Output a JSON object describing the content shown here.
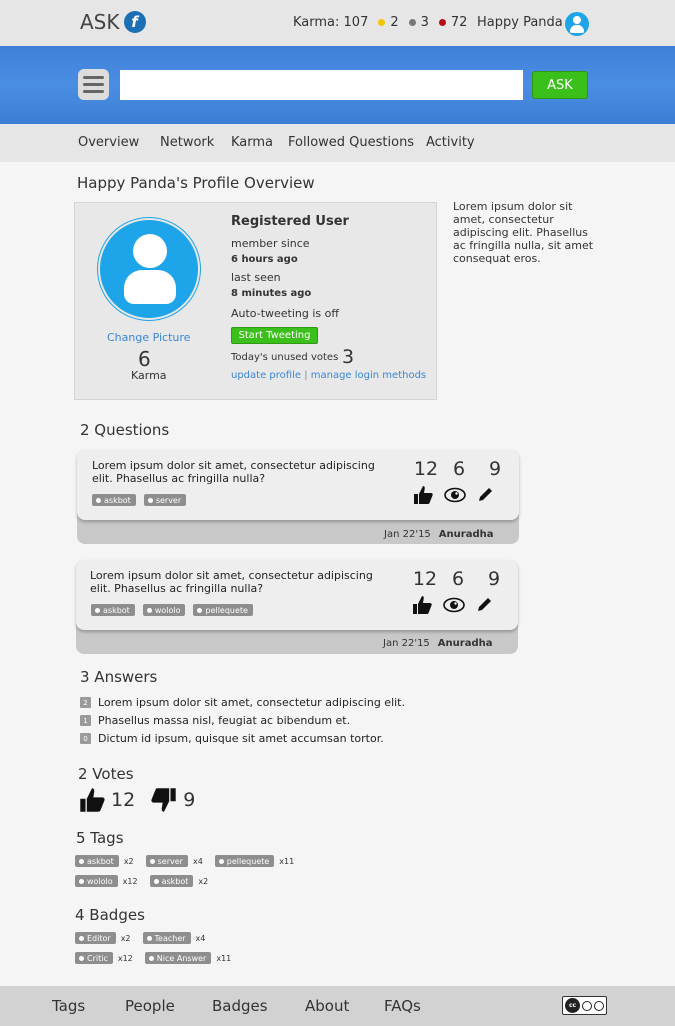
{
  "header": {
    "logo_text": "ASK",
    "logo_mark": "f",
    "karma_label": "Karma: 107",
    "badges": [
      {
        "count": "2",
        "color": "#f5c400"
      },
      {
        "count": "3",
        "color": "#777777"
      },
      {
        "count": "72",
        "color": "#b50f0f"
      }
    ],
    "username": "Happy Panda"
  },
  "search": {
    "placeholder": "",
    "button": "ASK"
  },
  "nav": [
    "Overview",
    "Network",
    "Karma",
    "Followed Questions",
    "Activity"
  ],
  "page_title": "Happy Panda's Profile Overview",
  "profile": {
    "change_picture": "Change Picture",
    "karma_value": "6",
    "karma_label": "Karma",
    "role": "Registered User",
    "member_since_label": "member since",
    "member_since_value": "6 hours ago",
    "last_seen_label": "last seen",
    "last_seen_value": "8 minutes ago",
    "autotweet": "Auto-tweeting is off",
    "tweet_button": "Start Tweeting",
    "unused_votes_label": "Today's unused votes",
    "unused_votes_value": "3",
    "update_profile": "update profile",
    "separator": "|",
    "manage_login": "manage login methods"
  },
  "side_text": "Lorem ipsum dolor sit amet, consectetur adipiscing elit. Phasellus ac fringilla nulla, sit amet consequat eros.",
  "questions": {
    "title": "2 Questions",
    "items": [
      {
        "text": "Lorem ipsum dolor sit amet, consectetur adipiscing elit. Phasellus ac fringilla nulla?",
        "tags": [
          "askbot",
          "server"
        ],
        "votes": "12",
        "views": "6",
        "edits": "9",
        "date": "Jan 22'15",
        "author": "Anuradha"
      },
      {
        "text": "Lorem ipsum dolor sit amet, consectetur adipiscing elit. Phasellus ac fringilla nulla?",
        "tags": [
          "askbot",
          "wololo",
          "pellequete"
        ],
        "votes": "12",
        "views": "6",
        "edits": "9",
        "date": "Jan 22'15",
        "author": "Anuradha"
      }
    ]
  },
  "answers": {
    "title": "3 Answers",
    "items": [
      {
        "num": "2",
        "text": "Lorem ipsum dolor sit amet, consectetur adipiscing elit."
      },
      {
        "num": "1",
        "text": "Phasellus massa nisl, feugiat ac bibendum et."
      },
      {
        "num": "0",
        "text": "Dictum id ipsum, quisque sit amet accumsan tortor."
      }
    ]
  },
  "votes": {
    "title": "2 Votes",
    "up": "12",
    "down": "9"
  },
  "tags_section": {
    "title": "5 Tags",
    "rows": [
      [
        {
          "name": "askbot",
          "mult": "x2"
        },
        {
          "name": "server",
          "mult": "x4"
        },
        {
          "name": "pellequete",
          "mult": "x11"
        }
      ],
      [
        {
          "name": "wololo",
          "mult": "x12"
        },
        {
          "name": "askbot",
          "mult": "x2"
        }
      ]
    ]
  },
  "badges_section": {
    "title": "4 Badges",
    "rows": [
      [
        {
          "name": "Editor",
          "mult": "x2"
        },
        {
          "name": "Teacher",
          "mult": "x4"
        }
      ],
      [
        {
          "name": "Critic",
          "mult": "x12"
        },
        {
          "name": "Nice Answer",
          "mult": "x11"
        }
      ]
    ]
  },
  "footer": [
    "Tags",
    "People",
    "Badges",
    "About",
    "FAQs"
  ],
  "license": {
    "cc": "cc",
    "by": "BY",
    "sa": "SA"
  }
}
